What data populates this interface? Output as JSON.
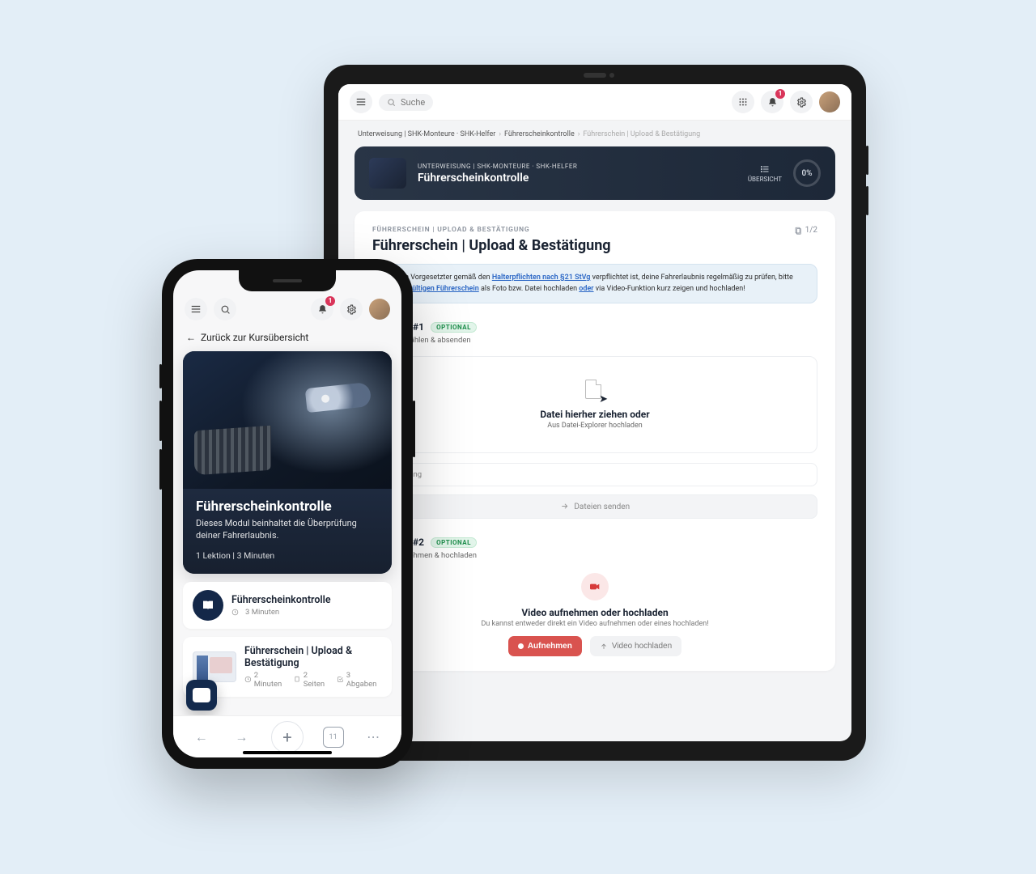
{
  "tablet": {
    "search_placeholder": "Suche",
    "notif_count": "1",
    "breadcrumb": {
      "a": "Unterweisung | SHK-Monteure · SHK-Helfer",
      "b": "Führerscheinkontrolle",
      "c": "Führerschein | Upload & Bestätigung"
    },
    "hero": {
      "eyebrow": "UNTERWEISUNG | SHK-MONTEURE · SHK-HELFER",
      "title": "Führerscheinkontrolle",
      "overview": "ÜBERSICHT",
      "percent": "0%"
    },
    "card": {
      "eyebrow": "FÜHRERSCHEIN | UPLOAD & BESTÄTIGUNG",
      "title": "Führerschein | Upload & Bestätigung",
      "pages": "1/2",
      "callout_pre": "Da dein Vorgesetzter gemäß den ",
      "callout_link1": "Halterpflichten nach §21 StVg",
      "callout_mid1": " verpflichtet ist, deine Fahrerlaubnis regelmäßig zu prüfen, bitte deinen ",
      "callout_link2": "gültigen Führerschein",
      "callout_mid2": " als Foto bzw. Datei hochladen ",
      "callout_link3": "oder",
      "callout_post": " via Video-Funktion kurz zeigen und hochladen!"
    },
    "task1": {
      "name": "Tätigkeit #1",
      "chip": "OPTIONAL",
      "sub": "Datei auswählen & absenden",
      "dz_title": "Datei hierher ziehen oder",
      "dz_sub": "Aus Datei-Explorer hochladen",
      "hint": "Darstellung",
      "send": "Dateien senden"
    },
    "task2": {
      "name": "Tätigkeit #2",
      "chip": "OPTIONAL",
      "sub": "Video aufnehmen & hochladen",
      "vz_title": "Video aufnehmen oder hochladen",
      "vz_sub": "Du kannst entweder direkt ein Video aufnehmen oder eines hochladen!",
      "btn_rec": "Aufnehmen",
      "btn_up": "Video hochladen"
    }
  },
  "phone": {
    "notif_count": "1",
    "back": "Zurück zur Kursübersicht",
    "card": {
      "title": "Führerscheinkontrolle",
      "desc": "Dieses Modul beinhaltet die Überprüfung deiner Fahrerlaubnis.",
      "meta": "1 Lektion | 3 Minuten"
    },
    "item1": {
      "title": "Führerscheinkontrolle",
      "meta_time": "3 Minuten"
    },
    "item2": {
      "title": "Führerschein | Upload & Bestätigung",
      "meta_time": "2 Minuten",
      "meta_pages": "2 Seiten",
      "meta_sub": "3 Abgaben"
    },
    "bottom_tab_count": "11"
  }
}
